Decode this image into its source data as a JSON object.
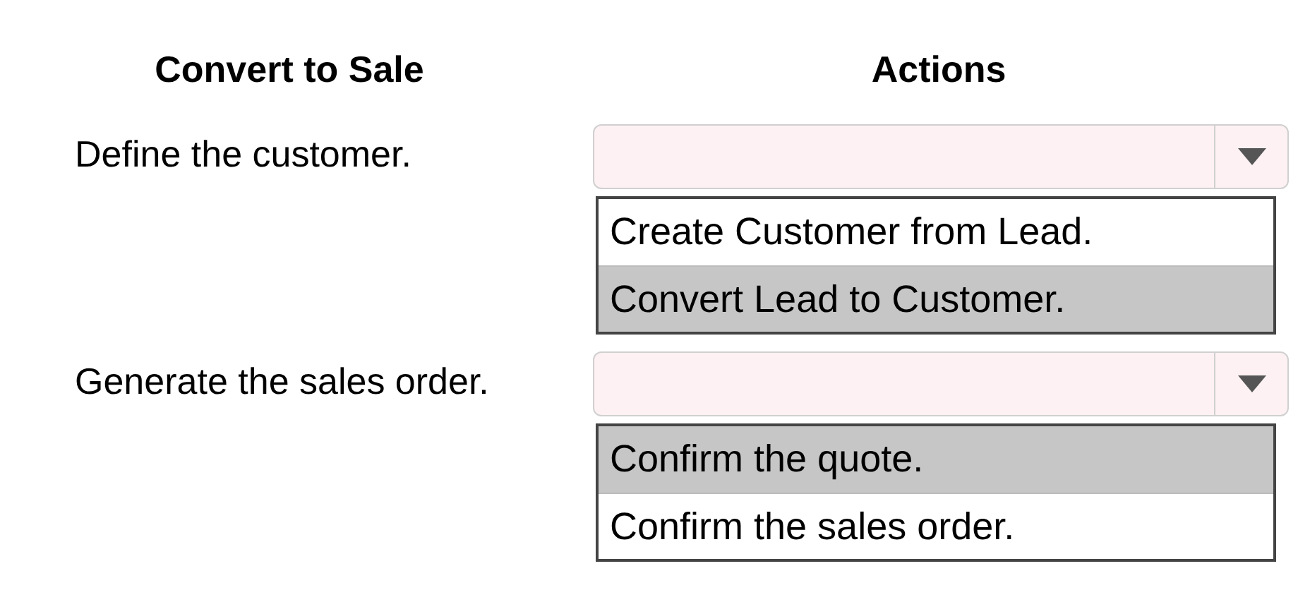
{
  "columns": [
    "Convert to Sale",
    "Actions"
  ],
  "rows": [
    {
      "label": "Define the customer.",
      "options": [
        {
          "label": "Create Customer from Lead.",
          "selected": false
        },
        {
          "label": "Convert Lead to Customer.",
          "selected": true
        }
      ]
    },
    {
      "label": "Generate the sales order.",
      "options": [
        {
          "label": "Confirm the quote.",
          "selected": true
        },
        {
          "label": "Confirm the sales order.",
          "selected": false
        }
      ]
    }
  ]
}
